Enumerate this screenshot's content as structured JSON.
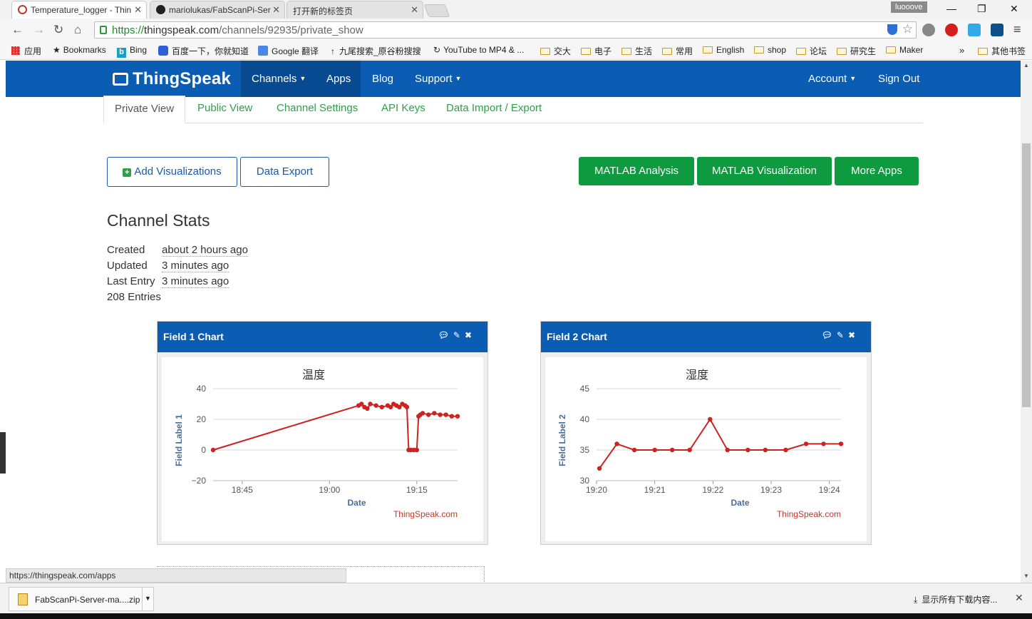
{
  "browser": {
    "tabs": [
      {
        "title": "Temperature_logger - Thin",
        "active": true,
        "icon": "thingspeak-icon"
      },
      {
        "title": "mariolukas/FabScanPi-Ser",
        "active": false,
        "icon": "github-icon"
      },
      {
        "title": "打开新的标签页",
        "active": false,
        "icon": ""
      }
    ],
    "profile": "luooove",
    "url_scheme": "https://",
    "url_host": "thingspeak.com",
    "url_path": "/channels/92935/private_show",
    "bookmarks": [
      {
        "label": "应用",
        "icon": "apps-grid-icon"
      },
      {
        "label": "Bookmarks",
        "icon": "star-icon"
      },
      {
        "label": "Bing",
        "icon": "bing-icon"
      },
      {
        "label": "百度一下，你就知道",
        "icon": "baidu-icon"
      },
      {
        "label": "Google 翻译",
        "icon": "google-translate-icon"
      },
      {
        "label": "九尾搜索_原谷粉搜搜",
        "icon": "arrow-up-icon"
      },
      {
        "label": "YouTube to MP4 & ...",
        "icon": "refresh-icon"
      },
      {
        "label": "交大",
        "icon": "folder-icon"
      },
      {
        "label": "电子",
        "icon": "folder-icon"
      },
      {
        "label": "生活",
        "icon": "folder-icon"
      },
      {
        "label": "常用",
        "icon": "folder-icon"
      },
      {
        "label": "English",
        "icon": "folder-icon"
      },
      {
        "label": "shop",
        "icon": "folder-icon"
      },
      {
        "label": "论坛",
        "icon": "folder-icon"
      },
      {
        "label": "研究生",
        "icon": "folder-icon"
      },
      {
        "label": "Maker",
        "icon": "folder-icon"
      }
    ],
    "bookmarks_overflow": "»",
    "other_bookmarks": "其他书签",
    "status_url": "https://thingspeak.com/apps",
    "download_file": "FabScanPi-Server-ma....zip",
    "download_show_all": "显示所有下载内容...",
    "colors": {
      "nav_blue": "#0b5cb3",
      "green": "#0e9a3f",
      "chart_line": "#cc2222"
    }
  },
  "site": {
    "logo": "ThingSpeak",
    "nav": {
      "channels": "Channels",
      "apps": "Apps",
      "blog": "Blog",
      "support": "Support",
      "account": "Account",
      "signout": "Sign Out"
    },
    "subtabs": [
      "Private View",
      "Public View",
      "Channel Settings",
      "API Keys",
      "Data Import / Export"
    ],
    "buttons": {
      "add_viz": "Add Visualizations",
      "data_export": "Data Export",
      "matlab_analysis": "MATLAB Analysis",
      "matlab_viz": "MATLAB Visualization",
      "more_apps": "More Apps"
    },
    "stats": {
      "title": "Channel Stats",
      "created_label": "Created",
      "created_value": "about 2 hours ago",
      "updated_label": "Updated",
      "updated_value": "3 minutes ago",
      "last_entry_label": "Last Entry",
      "last_entry_value": "3 minutes ago",
      "entries": "208 Entries"
    }
  },
  "chart_data": [
    {
      "panel_title": "Field 1 Chart",
      "type": "line",
      "title": "温度",
      "xlabel": "Date",
      "ylabel": "Field Label 1",
      "credit": "ThingSpeak.com",
      "ylim": [
        -20,
        40
      ],
      "yticks": [
        40,
        20,
        0,
        -20
      ],
      "xlim": [
        "18:40",
        "19:22"
      ],
      "xticks": [
        "18:45",
        "19:00",
        "19:15"
      ],
      "x": [
        "18:40",
        "19:05",
        "19:05.5",
        "19:06",
        "19:06.5",
        "19:07",
        "19:08",
        "19:09",
        "19:10",
        "19:10.5",
        "19:11",
        "19:11.5",
        "19:12",
        "19:12.5",
        "19:13",
        "19:13.3",
        "19:13.6",
        "19:14",
        "19:14.5",
        "19:15",
        "19:15.3",
        "19:15.6",
        "19:16",
        "19:17",
        "19:18",
        "19:19",
        "19:20",
        "19:21",
        "19:22"
      ],
      "y": [
        0,
        29,
        30,
        28,
        27,
        30,
        29,
        28,
        29,
        28,
        30,
        29,
        28,
        30,
        29,
        28,
        0,
        0,
        0,
        0,
        22,
        23,
        24,
        23,
        24,
        23,
        23,
        22,
        22
      ],
      "grid": true,
      "legend": "none"
    },
    {
      "panel_title": "Field 2 Chart",
      "type": "line",
      "title": "湿度",
      "xlabel": "Date",
      "ylabel": "Field Label 2",
      "credit": "ThingSpeak.com",
      "ylim": [
        30,
        45
      ],
      "yticks": [
        45,
        40,
        35,
        30
      ],
      "xlim": [
        "19:20",
        "19:24.2"
      ],
      "xticks": [
        "19:20",
        "19:21",
        "19:22",
        "19:23",
        "19:24"
      ],
      "x": [
        "19:20.05",
        "19:20.35",
        "19:20.65",
        "19:21",
        "19:21.3",
        "19:21.6",
        "19:21.95",
        "19:22.25",
        "19:22.6",
        "19:22.9",
        "19:23.25",
        "19:23.6",
        "19:23.9",
        "19:24.2"
      ],
      "y": [
        32,
        36,
        35,
        35,
        35,
        35,
        40,
        35,
        35,
        35,
        35,
        36,
        36,
        36
      ],
      "grid": true,
      "legend": "none"
    }
  ]
}
